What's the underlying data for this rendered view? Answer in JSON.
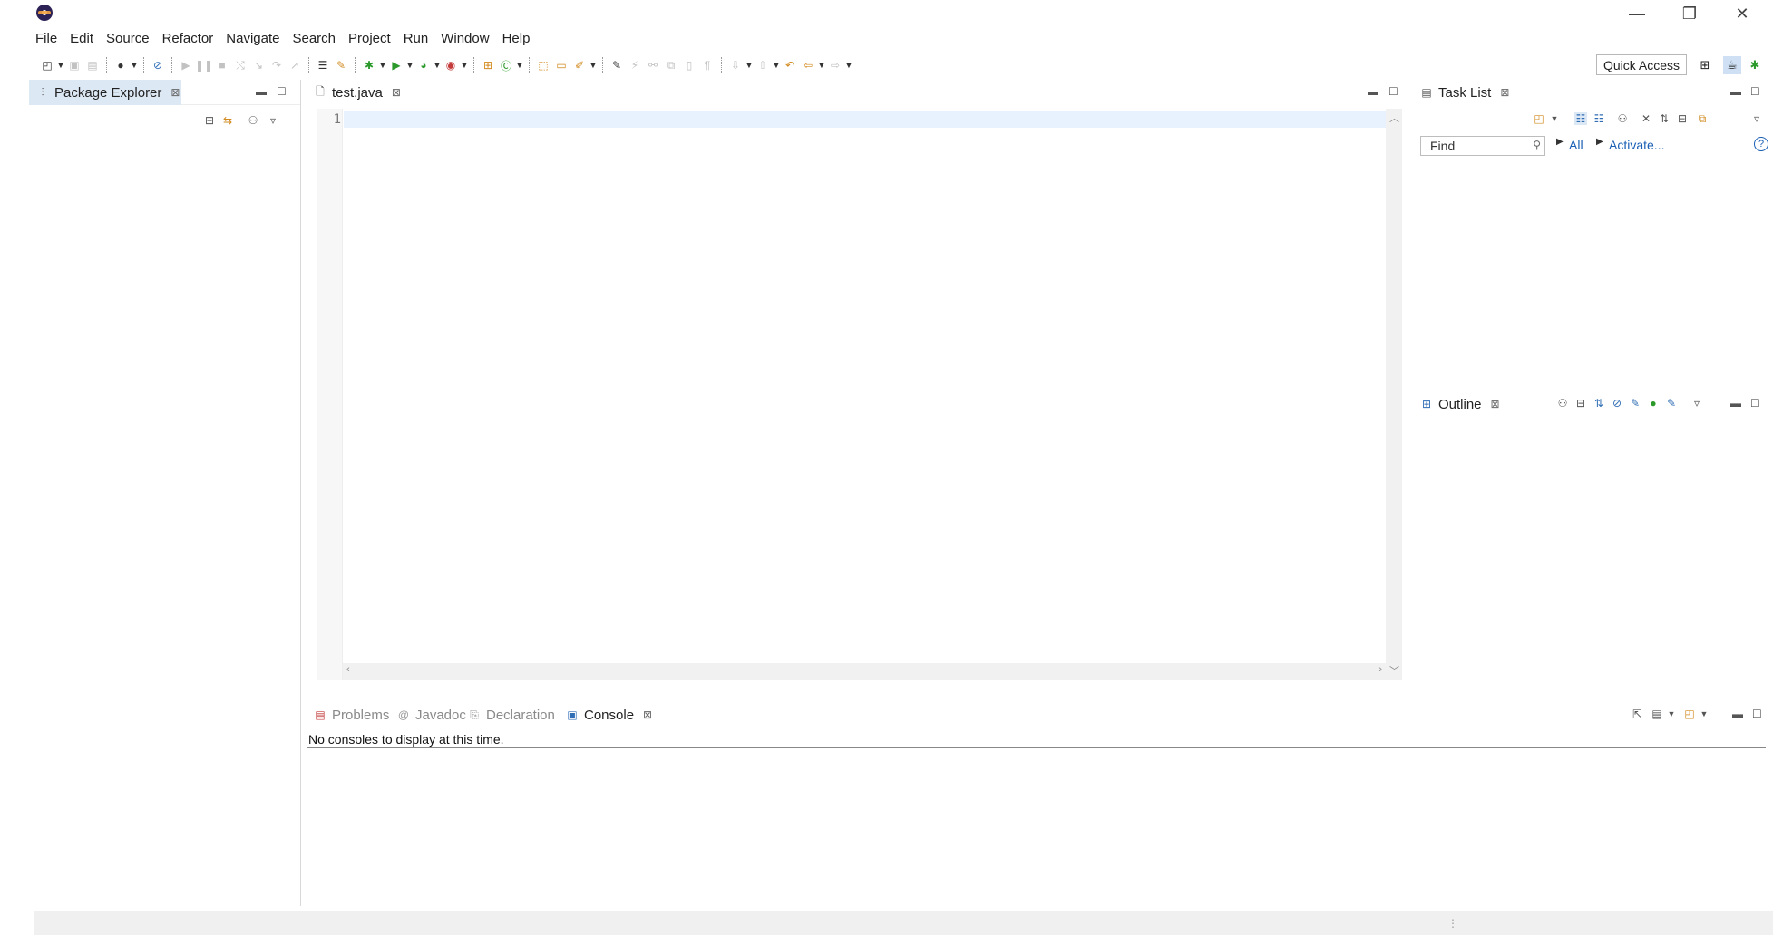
{
  "window": {
    "controls": {
      "minimize": "—",
      "restore": "❐",
      "close": "✕"
    }
  },
  "menu": [
    "File",
    "Edit",
    "Source",
    "Refactor",
    "Navigate",
    "Search",
    "Project",
    "Run",
    "Window",
    "Help"
  ],
  "toolbar": {
    "quick_access": "Quick Access"
  },
  "package_explorer": {
    "tab_label": "Package Explorer",
    "close_glyph": "⊠"
  },
  "editor": {
    "tab_label": "test.java",
    "close_glyph": "⊠",
    "line_numbers": [
      "1"
    ],
    "content": ""
  },
  "task_list": {
    "tab_label": "Task List",
    "close_glyph": "⊠",
    "find_placeholder": "Find",
    "filter_all": "All",
    "activate": "Activate..."
  },
  "outline": {
    "tab_label": "Outline",
    "close_glyph": "⊠"
  },
  "bottom_panel": {
    "tabs": [
      {
        "label": "Problems",
        "active": false
      },
      {
        "label": "Javadoc",
        "active": false
      },
      {
        "label": "Declaration",
        "active": false
      },
      {
        "label": "Console",
        "active": true
      }
    ],
    "close_glyph": "⊠",
    "console_message": "No consoles to display at this time."
  },
  "colors": {
    "active_tab_bg": "#dde8f5",
    "current_line_bg": "#e8f2fe",
    "link": "#1a5fb4"
  }
}
